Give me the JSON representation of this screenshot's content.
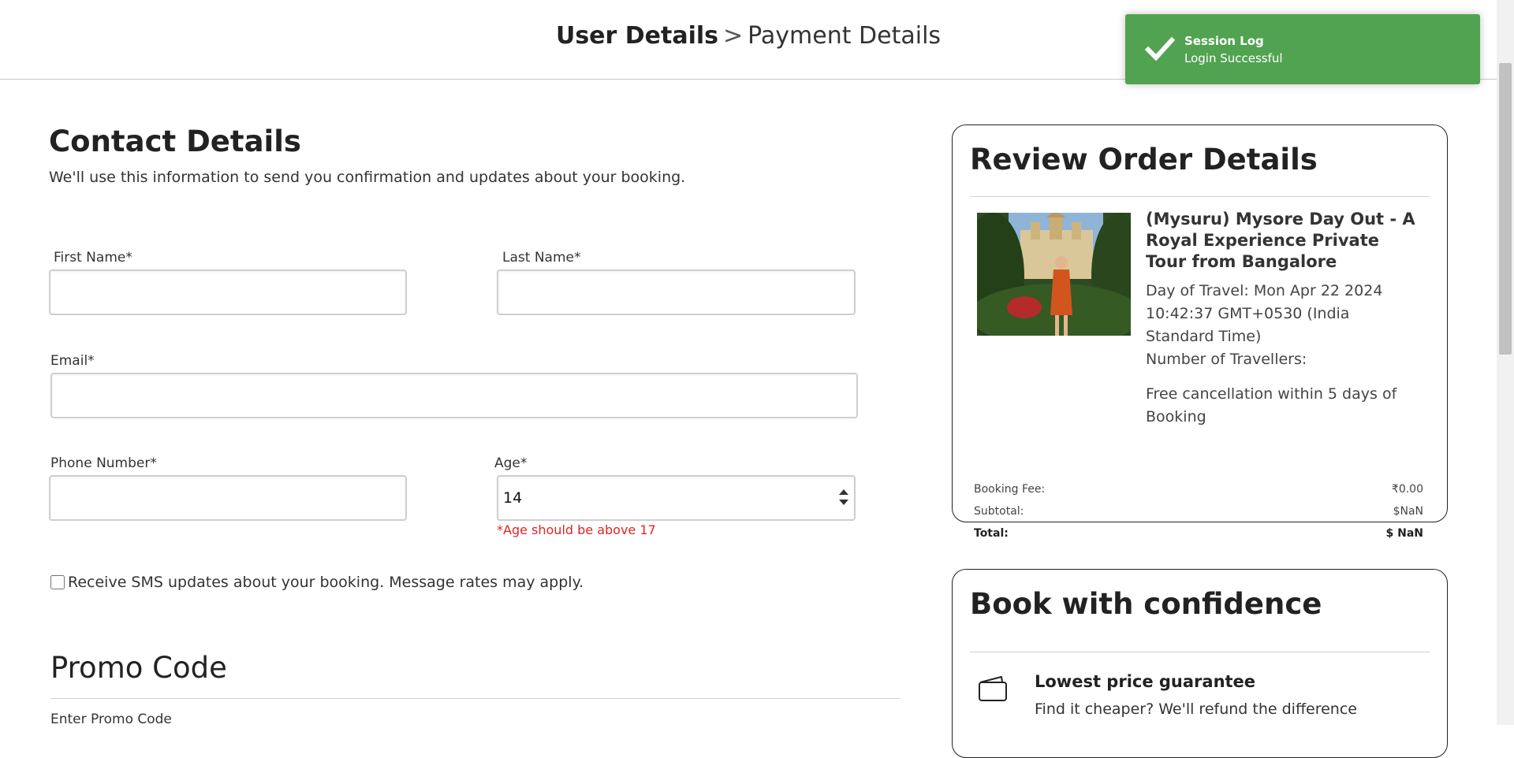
{
  "header": {
    "crumb_active": "User Details",
    "separator": ">",
    "crumb_next": "Payment Details"
  },
  "toast": {
    "title": "Session Log",
    "message": "Login Successful",
    "color": "#51a351",
    "icon": "check-icon"
  },
  "contact": {
    "title": "Contact Details",
    "subtitle": "We'll use this information to send you confirmation and updates about your booking.",
    "first_name_label": "First Name*",
    "first_name_value": "",
    "last_name_label": "Last Name*",
    "last_name_value": "",
    "email_label": "Email*",
    "email_value": "",
    "phone_label": "Phone Number*",
    "phone_value": "",
    "age_label": "Age*",
    "age_value": "14",
    "age_error": "*Age should be above 17",
    "sms_label": "Receive SMS updates about your booking. Message rates may apply.",
    "sms_checked": false
  },
  "promo": {
    "title": "Promo Code",
    "input_label": "Enter Promo Code"
  },
  "review": {
    "title": "Review Order Details",
    "tour_title": "(Mysuru) Mysore Day Out - A Royal Experience Private Tour from Bangalore",
    "day_of_travel": "Day of Travel: Mon Apr 22 2024 10:42:37 GMT+0530 (India Standard Time)",
    "travellers": "Number of Travellers:",
    "cancellation": "Free cancellation within 5 days of Booking",
    "booking_fee_label": "Booking Fee:",
    "booking_fee_value": "₹0.00",
    "subtotal_label": "Subtotal:",
    "subtotal_value": "$NaN",
    "total_label": "Total:",
    "total_value": "$ NaN"
  },
  "confidence": {
    "title": "Book with confidence",
    "feature_title": "Lowest price guarantee",
    "feature_desc": "Find it cheaper? We'll refund the difference",
    "feature_icon": "wallet-icon"
  },
  "colors": {
    "error": "#e02424",
    "toast_bg": "#51a351"
  }
}
